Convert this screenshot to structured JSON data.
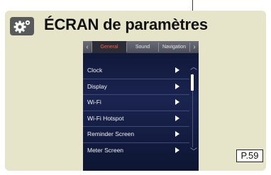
{
  "header": {
    "title": "ÉCRAN de paramètres",
    "icon": "gear-icon"
  },
  "screen": {
    "tabs": [
      {
        "label": "General",
        "active": true
      },
      {
        "label": "Sound",
        "active": false
      },
      {
        "label": "Navigation",
        "active": false
      }
    ],
    "menu_items": [
      {
        "label": "Clock"
      },
      {
        "label": "Display"
      },
      {
        "label": "Wi-Fi"
      },
      {
        "label": "Wi-Fi Hotspot"
      },
      {
        "label": "Reminder Screen"
      },
      {
        "label": "Meter Screen"
      }
    ],
    "active_tab_color": "#ff5a48"
  },
  "page_ref": "P.59"
}
